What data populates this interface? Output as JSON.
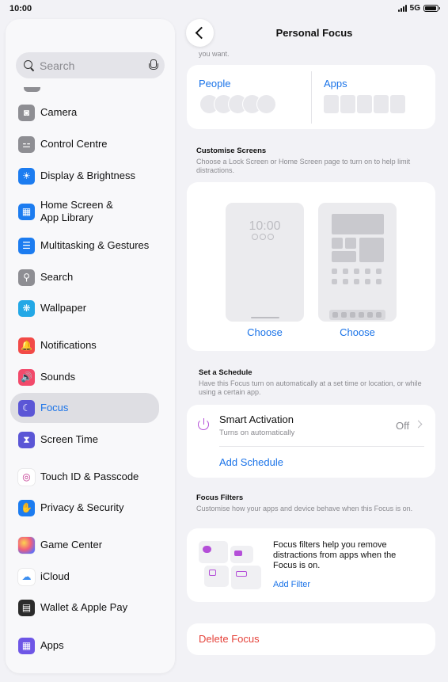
{
  "status_bar": {
    "time": "10:00",
    "network": "5G",
    "battery_level": 0.9
  },
  "sidebar": {
    "search_placeholder": "Search",
    "items": [
      {
        "label": "Camera",
        "icon": "camera-icon",
        "color": "#8e8e93",
        "glyph": "◙"
      },
      {
        "label": "Control Centre",
        "icon": "toggles-icon",
        "color": "#8e8e93",
        "glyph": "⚍"
      },
      {
        "label": "Display & Brightness",
        "icon": "sun-icon",
        "color": "#1c7cf0",
        "glyph": "☀"
      },
      {
        "label": "Home Screen &\nApp Library",
        "icon": "home-screen-icon",
        "color": "#1c7cf0",
        "glyph": "▦"
      },
      {
        "label": "Multitasking & Gestures",
        "icon": "multitasking-icon",
        "color": "#1c7cf0",
        "glyph": "☰"
      },
      {
        "label": "Search",
        "icon": "search-icon",
        "color": "#8e8e93",
        "glyph": "⚲"
      },
      {
        "label": "Wallpaper",
        "icon": "wallpaper-icon",
        "color": "#23a8e6",
        "glyph": "❋"
      },
      {
        "label": "Notifications",
        "icon": "bell-icon",
        "color": "#f24a47",
        "glyph": "🔔"
      },
      {
        "label": "Sounds",
        "icon": "speaker-icon",
        "color": "#f24a6b",
        "glyph": "🔊"
      },
      {
        "label": "Focus",
        "icon": "moon-icon",
        "color": "#5b56d6",
        "glyph": "☾"
      },
      {
        "label": "Screen Time",
        "icon": "hourglass-icon",
        "color": "#5b56d6",
        "glyph": "⧗"
      },
      {
        "label": "Touch ID & Passcode",
        "icon": "fingerprint-icon",
        "color": "#ffffff",
        "glyph": "◎"
      },
      {
        "label": "Privacy & Security",
        "icon": "hand-icon",
        "color": "#1c7cf0",
        "glyph": "✋"
      },
      {
        "label": "Game Center",
        "icon": "game-center-icon",
        "color": "#ffffff",
        "glyph": "●"
      },
      {
        "label": "iCloud",
        "icon": "cloud-icon",
        "color": "#ffffff",
        "glyph": "☁"
      },
      {
        "label": "Wallet & Apple Pay",
        "icon": "wallet-icon",
        "color": "#2b2b2b",
        "glyph": "▤"
      },
      {
        "label": "Apps",
        "icon": "apps-grid-icon",
        "color": "#6e56e6",
        "glyph": "▦"
      }
    ],
    "selected": "Focus"
  },
  "main": {
    "title": "Personal Focus",
    "cut_text": "you want.",
    "people_label": "People",
    "apps_label": "Apps",
    "customise": {
      "heading": "Customise Screens",
      "description": "Choose a Lock Screen or Home Screen page to turn on to help limit distractions.",
      "lock_time": "10:00",
      "choose_lock": "Choose",
      "choose_home": "Choose"
    },
    "schedule": {
      "heading": "Set a Schedule",
      "description": "Have this Focus turn on automatically at a set time or location, or while using a certain app.",
      "smart_activation": "Smart Activation",
      "smart_sub": "Turns on automatically",
      "smart_value": "Off",
      "add_schedule": "Add Schedule"
    },
    "filters": {
      "heading": "Focus Filters",
      "description": "Customise how your apps and device behave when this Focus is on.",
      "text": "Focus filters help you remove distractions from apps when the Focus is on.",
      "add_filter": "Add Filter"
    },
    "delete_label": "Delete Focus"
  },
  "colors": {
    "accent": "#1a73e8",
    "destructive": "#e5423a",
    "focus_purple": "#b44fd8"
  }
}
